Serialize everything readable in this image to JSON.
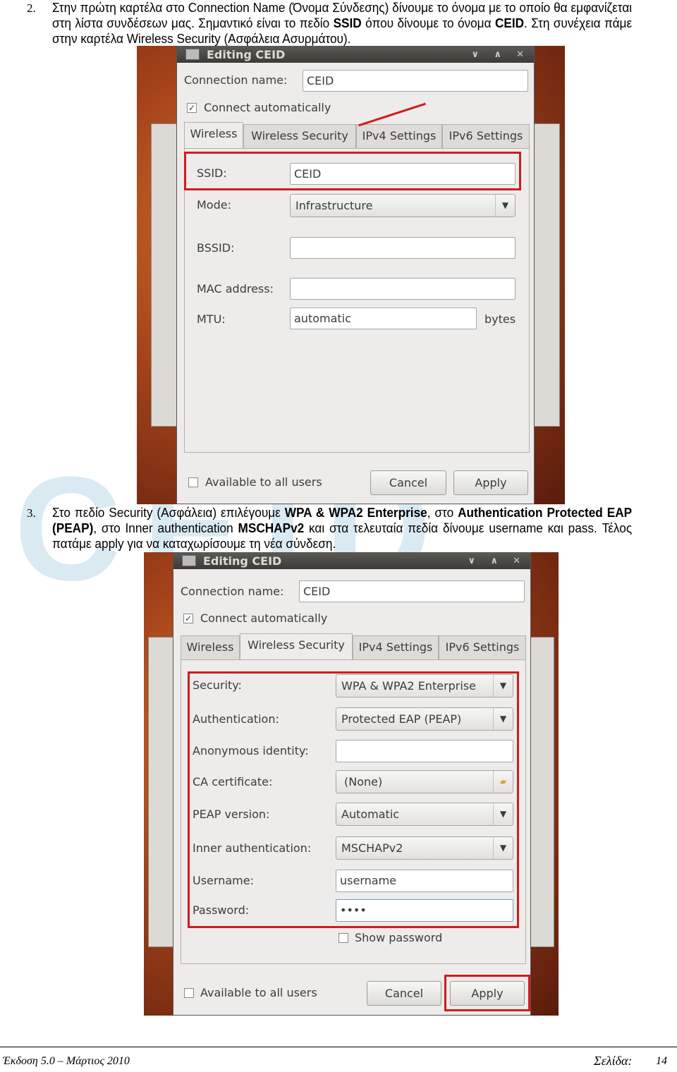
{
  "step2": {
    "number": "2.",
    "t1": "Στην πρώτη καρτέλα στο Connection Name (Όνομα Σύνδεσης) δίνουμε το όνομα με το οποίο θα εμφανίζεται στη λίστα συνδέσεων μας. Σημαντικό είναι το πεδίο ",
    "b1": "SSID",
    "t2": " όπου δίνουμε το όνομα ",
    "b2": "CEID",
    "t3": ". Στη συνέχεια πάμε στην καρτέλα Wireless Security (Ασφάλεια Ασυρμάτου)."
  },
  "step3": {
    "number": "3.",
    "t1": "Στο πεδίο Security (Ασφάλεια) επιλέγουμε ",
    "b1": "WPA & WPA2 Enterprise",
    "t2": ", στο ",
    "b2": "Authentication Protected EAP (PEAP)",
    "t3": ", στο Inner authentication ",
    "b3": "MSCHAPv2",
    "t4": " και στα τελευταία πεδία δίνουμε username και pass. Τέλος πατάμε apply για να καταχωρίσουμε τη νέα σύνδεση."
  },
  "dialog": {
    "title": "Editing CEID",
    "connection_name_label": "Connection name:",
    "connection_name": "CEID",
    "connect_auto": "Connect automatically",
    "tabs": [
      "Wireless",
      "Wireless Security",
      "IPv4 Settings",
      "IPv6 Settings"
    ],
    "available_all": "Available to all users",
    "cancel": "Cancel",
    "apply": "Apply",
    "controls": [
      "∨",
      "∧",
      "✕"
    ]
  },
  "wireless": {
    "ssid_label": "SSID:",
    "ssid": "CEID",
    "mode_label": "Mode:",
    "mode": "Infrastructure",
    "bssid_label": "BSSID:",
    "bssid": "",
    "mac_label": "MAC address:",
    "mac": "",
    "mtu_label": "MTU:",
    "mtu": "automatic",
    "mtu_unit": "bytes"
  },
  "security": {
    "security_label": "Security:",
    "security": "WPA & WPA2 Enterprise",
    "auth_label": "Authentication:",
    "auth": "Protected EAP (PEAP)",
    "anon_label": "Anonymous identity:",
    "anon": "",
    "ca_label": "CA certificate:",
    "ca": "(None)",
    "peap_label": "PEAP version:",
    "peap": "Automatic",
    "inner_label": "Inner authentication:",
    "inner": "MSCHAPv2",
    "user_label": "Username:",
    "user": "username",
    "pass_label": "Password:",
    "pass": "••••",
    "show_pass": "Show password"
  },
  "footer": {
    "edition": "Έκδοση 5.0 – Μάρτιος  2010",
    "page_label": "Σελίδα:",
    "page": "14"
  },
  "colors": {
    "highlight": "#d01c1c",
    "title_bar": "#3c3b37"
  }
}
